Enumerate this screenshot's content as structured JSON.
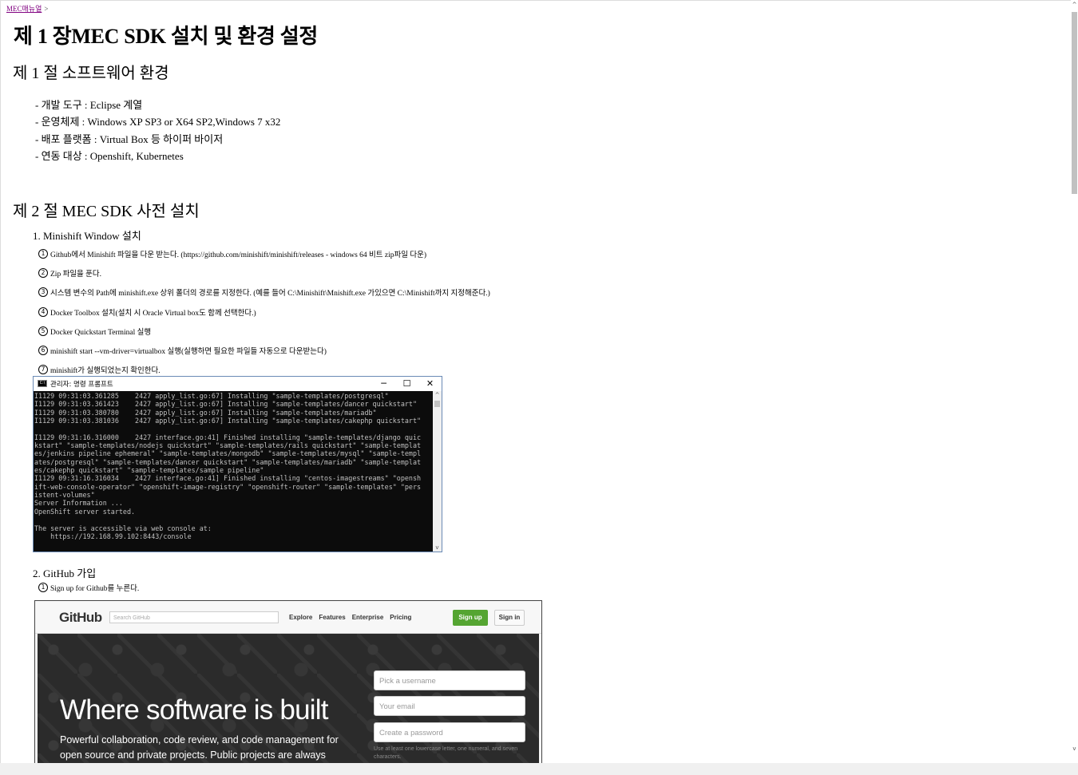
{
  "breadcrumb": {
    "link": "MEC매뉴얼",
    "sep": ">"
  },
  "title": "제 1 장MEC SDK 설치 및 환경 설정",
  "section1": {
    "heading": "제 1 절 소프트웨어 환경",
    "items": [
      "- 개발 도구 : Eclipse 계열",
      "- 운영체제 : Windows XP SP3 or X64 SP2,Windows 7 x32",
      "- 배포 플랫폼 : Virtual Box 등 하이퍼 바이저",
      "- 연동 대상 : Openshift, Kubernetes"
    ]
  },
  "section2": {
    "heading": "제 2 절 MEC SDK 사전 설치",
    "sub1": "1. Minishift Window 설치",
    "steps": [
      {
        "num": "1",
        "text": "Github에서 Minishift 파일을 다운 받는다. (https://github.com/minishift/minishift/releases - windows 64 비트 zip파일 다운)"
      },
      {
        "num": "2",
        "text": "Zip 파일을 푼다."
      },
      {
        "num": "3",
        "text": "시스템 변수의 Path에 minishift.exe 상위 폴더의 경로를 지정한다. (예를 들어 C:\\Minishift\\Mnishift.exe 가있으면 C:\\Minishift까지 지정해준다.)"
      },
      {
        "num": "4",
        "text": "Docker Toolbox 설치(설치 시 Oracle Virtual box도 함께 선택한다.)"
      },
      {
        "num": "5",
        "text": "Docker Quickstart Terminal 실행"
      },
      {
        "num": "6",
        "text": "minishift start --vm-driver=virtualbox 실행(실행하면 필요한 파일들 자동으로 다운받는다)"
      },
      {
        "num": "7",
        "text": "minishift가 실행되었는지 확인한다."
      }
    ],
    "sub2": "2. GitHub 가입",
    "step2": {
      "num": "1",
      "text": "Sign up for Github를 누른다."
    }
  },
  "cmd": {
    "title": "관리자: 명령 프롬프트",
    "output": "I1129 09:31:03.361285    2427 apply_list.go:67] Installing \"sample-templates/postgresql\"\nI1129 09:31:03.361423    2427 apply_list.go:67] Installing \"sample-templates/dancer quickstart\"\nI1129 09:31:03.380780    2427 apply_list.go:67] Installing \"sample-templates/mariadb\"\nI1129 09:31:03.381036    2427 apply_list.go:67] Installing \"sample-templates/cakephp quickstart\"\n\nI1129 09:31:16.316000    2427 interface.go:41] Finished installing \"sample-templates/django quic\nkstart\" \"sample-templates/nodejs quickstart\" \"sample-templates/rails quickstart\" \"sample-templat\nes/jenkins pipeline ephemeral\" \"sample-templates/mongodb\" \"sample-templates/mysql\" \"sample-templ\nates/postgresql\" \"sample-templates/dancer quickstart\" \"sample-templates/mariadb\" \"sample-templat\nes/cakephp quickstart\" \"sample-templates/sample pipeline\"\nI1129 09:31:16.316034    2427 interface.go:41] Finished installing \"centos-imagestreams\" \"opensh\nift-web-console-operator\" \"openshift-image-registry\" \"openshift-router\" \"sample-templates\" \"pers\nistent-volumes\"\nServer Information ...\nOpenShift server started.\n\nThe server is accessible via web console at:\n    https://192.168.99.102:8443/console"
  },
  "github": {
    "logo": "GitHub",
    "search_placeholder": "Search GitHub",
    "nav": [
      "Explore",
      "Features",
      "Enterprise",
      "Pricing"
    ],
    "signup": "Sign up",
    "signin": "Sign in",
    "hero_title": "Where software is built",
    "hero_sub": "Powerful collaboration, code review, and code management for open source and private projects. Public projects are always",
    "username_placeholder": "Pick a username",
    "email_placeholder": "Your email",
    "password_placeholder": "Create a password",
    "password_hint": "Use at least one lowercase letter, one numeral, and seven characters."
  }
}
